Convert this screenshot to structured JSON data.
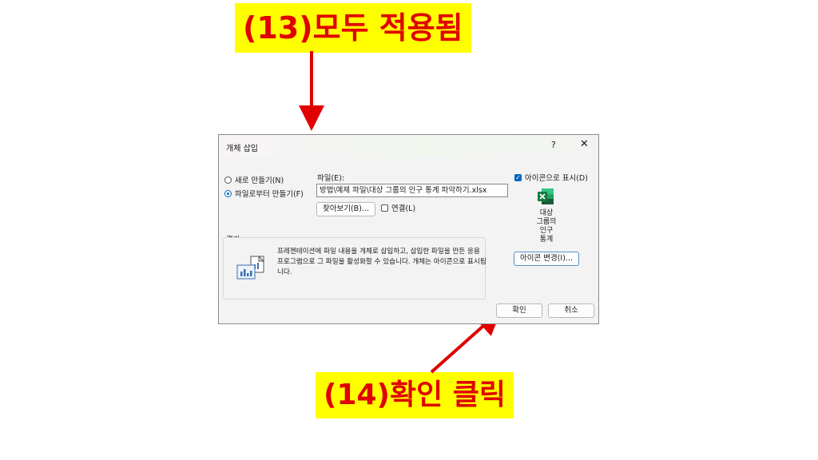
{
  "annotations": {
    "top_label": "(13)모두 적용됨",
    "bottom_label": "(14)확인 클릭"
  },
  "dialog": {
    "title": "개체 삽입",
    "help": "?",
    "close": "✕",
    "options": {
      "create_new": "새로 만들기(N)",
      "create_from_file": "파일로부터 만들기(F)",
      "selected": "create_from_file"
    },
    "file": {
      "label": "파일(E):",
      "value": "방법\\예제 파일\\대상 그룹의 인구 통계 파악하기.xlsx",
      "browse_button": "찾아보기(B)...",
      "link_label": "연결(L)",
      "link_checked": false
    },
    "display_as_icon": {
      "label": "아이콘으로 표시(D)",
      "checked": true,
      "icon": "excel-icon",
      "icon_caption": "대상\n그룹의\n인구\n통계",
      "change_icon_button": "아이콘 변경(I)..."
    },
    "result": {
      "label": "결과",
      "text": "프레젠테이션에 파일 내용을 개체로 삽입하고, 삽입한 파일을 만든 응용 프로그램으로 그 파일을 활성화할 수 있습니다. 개체는 아이콘으로 표시됩니다."
    },
    "ok_button": "확인",
    "cancel_button": "취소"
  },
  "colors": {
    "annotation_bg": "#ffff00",
    "annotation_text": "#e00000",
    "arrow": "#e00000",
    "accent": "#0067c0",
    "excel_green": "#107c41"
  }
}
